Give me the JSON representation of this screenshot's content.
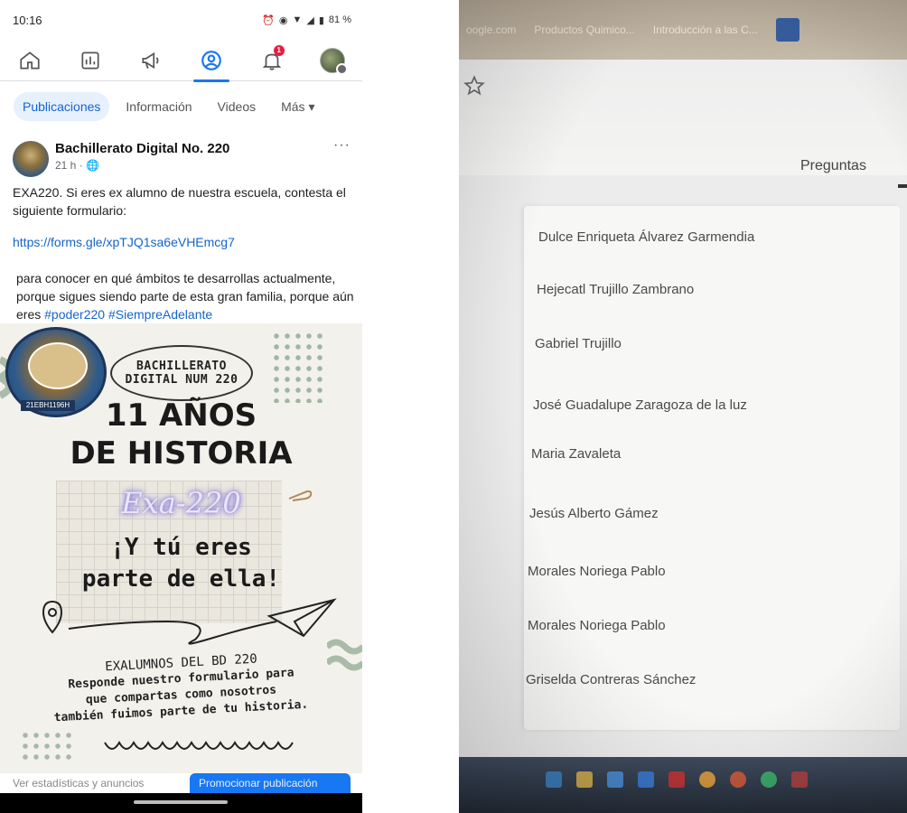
{
  "phone": {
    "status": {
      "time": "10:16",
      "battery": "81 %"
    },
    "nav": {
      "items": [
        {
          "icon": "home-icon"
        },
        {
          "icon": "dashboard-icon"
        },
        {
          "icon": "megaphone-icon"
        },
        {
          "icon": "profile-icon",
          "active": true
        },
        {
          "icon": "bell-icon",
          "badge": "1"
        },
        {
          "icon": "avatar-menu-icon"
        }
      ],
      "accent": "#1877f2",
      "badge_color": "#e41e3f"
    },
    "tabs": [
      "Publicaciones",
      "Información",
      "Videos",
      "Más ▾"
    ],
    "post": {
      "page_name": "Bachillerato Digital No. 220",
      "time": "21 h · 🌐",
      "menu": "···",
      "text1": "EXA220. Si eres ex alumno de nuestra escuela, contesta el siguiente formulario:",
      "link": "https://forms.gle/xpTJQ1sa6eVHEmcg7",
      "text2": "para conocer en qué ámbitos te desarrollas actualmente, porque sigues siendo parte de esta gran familia, porque aún eres",
      "hashtag1": "#poder220",
      "hashtag2": "#SiempreAdelante"
    },
    "poster": {
      "seal_town": "Xaltianquis",
      "seal_code": "21EBH1196H",
      "bubble_line1": "BACHILLERATO",
      "bubble_line2": "DIGITAL NUM 220",
      "title1": "11 AÑOS",
      "title2": "DE HISTORIA",
      "exa": "Exa-220",
      "line1": "¡Y tú eres",
      "line2": "parte de ella!",
      "foot1": "EXALUMNOS DEL BD 220",
      "foot2": "Responde nuestro formulario para",
      "foot3": "que compartas como nosotros",
      "foot4": "también fuimos parte de tu historia."
    },
    "actions": {
      "left_label": "Ver estadísticas y anuncios",
      "button_label": "Promocionar publicación"
    }
  },
  "photo": {
    "browser_tabs": [
      "oogle.com",
      "Productos Quimico...",
      "Introducción a las C..."
    ],
    "tab_label": "Preguntas",
    "names": [
      "Dulce Enriqueta Álvarez Garmendia",
      "Hejecatl Trujillo Zambrano",
      "Gabriel Trujillo",
      "José Guadalupe Zaragoza de la luz",
      "Maria Zavaleta",
      "Jesús Alberto Gámez",
      "Morales Noriega Pablo",
      "Morales Noriega Pablo",
      "Griselda Contreras Sánchez"
    ]
  }
}
